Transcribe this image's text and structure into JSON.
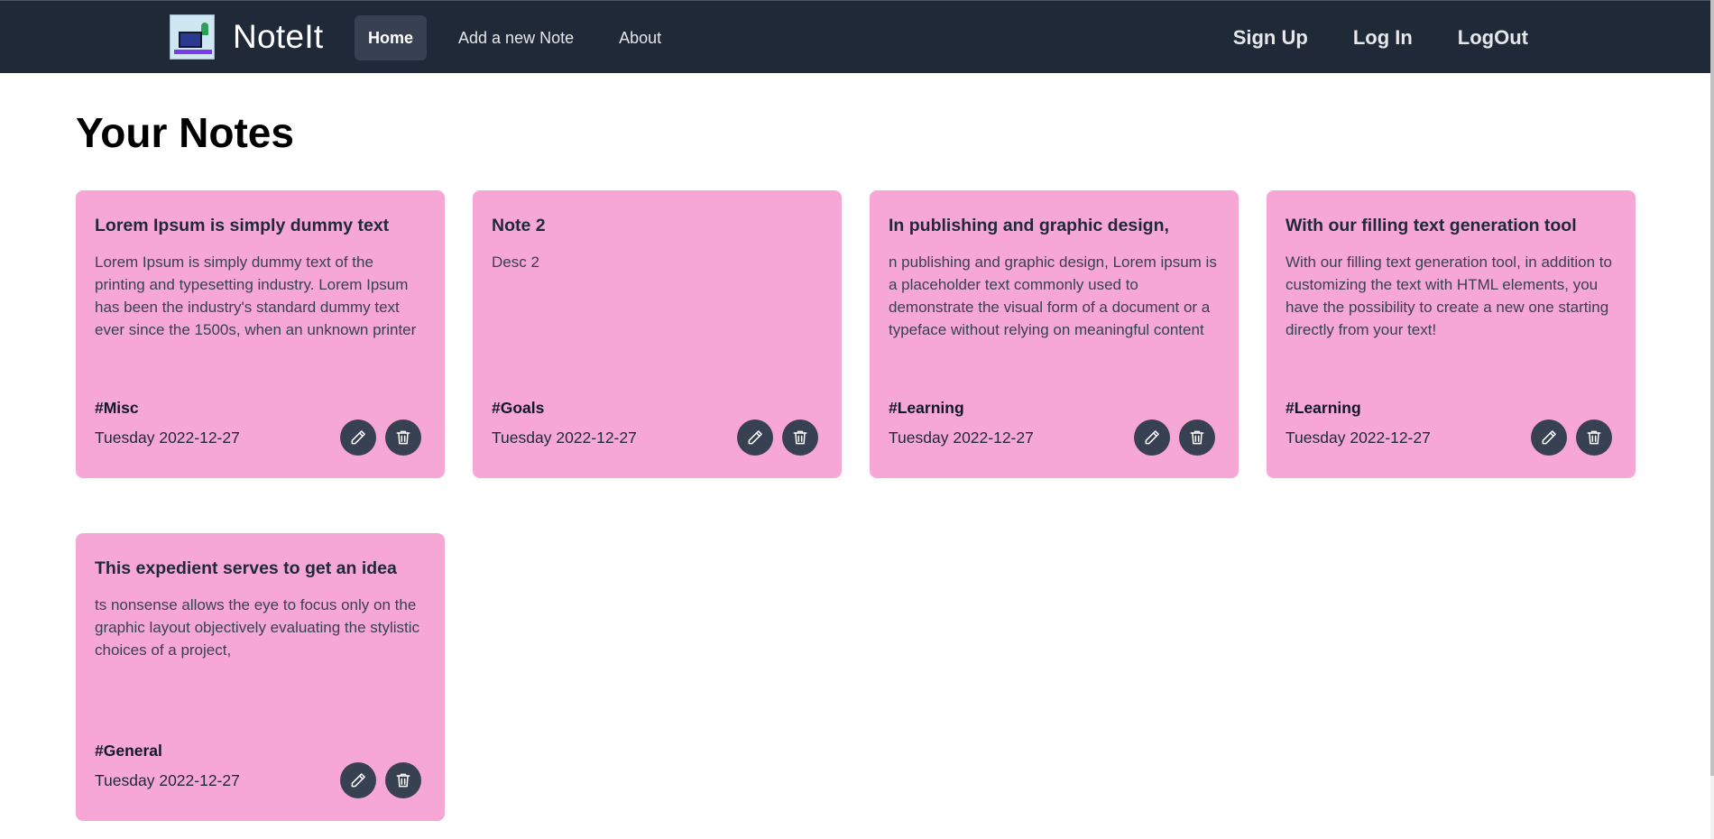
{
  "navbar": {
    "brand": "NoteIt",
    "links": [
      {
        "label": "Home",
        "active": true
      },
      {
        "label": "Add a new Note",
        "active": false
      },
      {
        "label": "About",
        "active": false
      }
    ],
    "auth": [
      {
        "label": "Sign Up"
      },
      {
        "label": "Log In"
      },
      {
        "label": "LogOut"
      }
    ]
  },
  "main": {
    "title": "Your Notes",
    "notes": [
      {
        "title": "Lorem Ipsum is simply dummy text",
        "description": "Lorem Ipsum is simply dummy text of the printing and typesetting industry. Lorem Ipsum has been the industry's standard dummy text ever since the 1500s, when an unknown printer",
        "tag": "#Misc",
        "date": "Tuesday 2022-12-27"
      },
      {
        "title": "Note 2",
        "description": "Desc 2",
        "tag": "#Goals",
        "date": "Tuesday 2022-12-27"
      },
      {
        "title": "In publishing and graphic design,",
        "description": "n publishing and graphic design, Lorem ipsum is a placeholder text commonly used to demonstrate the visual form of a document or a typeface without relying on meaningful content",
        "tag": "#Learning",
        "date": "Tuesday 2022-12-27"
      },
      {
        "title": "With our filling text generation tool",
        "description": "With our filling text generation tool, in addition to customizing the text with HTML elements, you have the possibility to create a new one starting directly from your text!",
        "tag": "#Learning",
        "date": "Tuesday 2022-12-27"
      },
      {
        "title": "This expedient serves to get an idea",
        "description": "ts nonsense allows the eye to focus only on the graphic layout objectively evaluating the stylistic choices of a project,",
        "tag": "#General",
        "date": "Tuesday 2022-12-27"
      }
    ]
  },
  "icons": {
    "edit": "pencil-icon",
    "delete": "trash-icon"
  },
  "colors": {
    "navbar_bg": "#1f2937",
    "card_bg": "#f7a7d5",
    "button_bg": "#374151"
  }
}
